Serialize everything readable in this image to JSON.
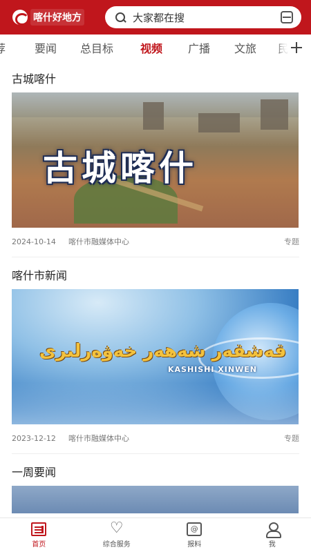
{
  "header": {
    "logo_text": "喀什好地方",
    "search_placeholder": "大家都在搜"
  },
  "tabs": [
    {
      "label": "荐"
    },
    {
      "label": "要闻"
    },
    {
      "label": "总目标"
    },
    {
      "label": "视频",
      "active": true
    },
    {
      "label": "广播"
    },
    {
      "label": "文旅"
    },
    {
      "label": "民"
    }
  ],
  "feed": [
    {
      "title": "古城喀什",
      "thumb_caption": "古城喀什",
      "date": "2024-10-14",
      "source": "喀什市融媒体中心",
      "tag": "专题"
    },
    {
      "title": "喀什市新闻",
      "thumb_caption_uy": "قەشقەر شەھەر خەۋەرلىرى",
      "thumb_caption_en": "KASHISHI XINWEN",
      "date": "2023-12-12",
      "source": "喀什市融媒体中心",
      "tag": "专题"
    },
    {
      "title": "一周要闻"
    }
  ],
  "bottom_nav": [
    {
      "label": "首页",
      "active": true
    },
    {
      "label": "综合服务"
    },
    {
      "label": "报料"
    },
    {
      "label": "我"
    }
  ],
  "colors": {
    "brand": "#c0161c"
  }
}
